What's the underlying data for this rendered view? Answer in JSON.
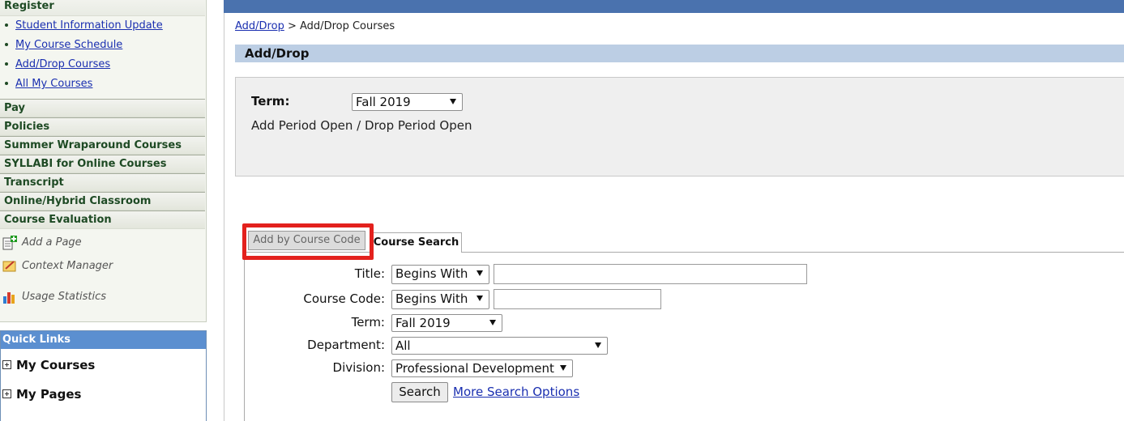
{
  "sidebar": {
    "register_header": "Register",
    "register_links": [
      "Student Information Update",
      "My Course Schedule",
      "Add/Drop Courses",
      "All My Courses"
    ],
    "sections": [
      "Pay",
      "Policies",
      "Summer Wraparound Courses",
      "SYLLABI for Online Courses",
      "Transcript",
      "Online/Hybrid Classroom",
      "Course Evaluation"
    ],
    "tools": [
      {
        "label": "Add a Page",
        "icon": "add-page-icon"
      },
      {
        "label": "Context Manager",
        "icon": "context-manager-icon"
      },
      {
        "label": "Usage Statistics",
        "icon": "bar-chart-icon"
      }
    ]
  },
  "quick_links": {
    "header": "Quick Links",
    "items": [
      "My Courses",
      "My Pages"
    ]
  },
  "breadcrumb": {
    "link": "Add/Drop",
    "separator": ">",
    "current": "Add/Drop Courses"
  },
  "page_title": "Add/Drop",
  "term_section": {
    "label": "Term:",
    "selected": "Fall 2019",
    "status": "Add Period Open / Drop Period Open"
  },
  "tabs": {
    "add_by_code": "Add by Course Code",
    "course_search": "Course Search"
  },
  "search_form": {
    "title_label": "Title:",
    "title_mode": "Begins With",
    "title_value": "",
    "code_label": "Course Code:",
    "code_mode": "Begins With",
    "code_value": "",
    "term_label": "Term:",
    "term_value": "Fall 2019",
    "department_label": "Department:",
    "department_value": "All",
    "division_label": "Division:",
    "division_value": "Professional Development",
    "search_button": "Search",
    "more_options": "More Search Options"
  },
  "colors": {
    "top_bar": "#4a72ae",
    "title_bar": "#bccee4",
    "link": "#1a2fb0",
    "highlight": "#e3211d",
    "quick_links_header": "#5b8fd0"
  }
}
